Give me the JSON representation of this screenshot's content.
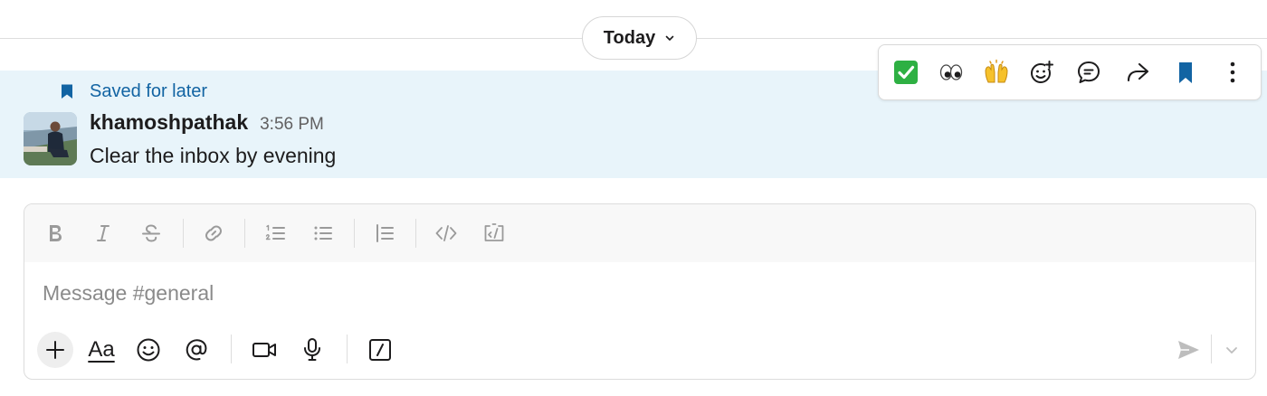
{
  "date_divider": {
    "label": "Today"
  },
  "message": {
    "saved_label": "Saved for later",
    "author": "khamoshpathak",
    "time": "3:56 PM",
    "text": "Clear the inbox by evening"
  },
  "message_actions": [
    {
      "name": "check-mark-reaction",
      "icon": "white-check-mark-emoji"
    },
    {
      "name": "eyes-reaction",
      "icon": "eyes-emoji"
    },
    {
      "name": "raised-hands-reaction",
      "icon": "raised-hands-emoji"
    },
    {
      "name": "add-reaction",
      "icon": "add-emoji-icon"
    },
    {
      "name": "reply-in-thread",
      "icon": "thread-icon"
    },
    {
      "name": "share-message",
      "icon": "forward-icon"
    },
    {
      "name": "save-for-later",
      "icon": "bookmark-icon"
    },
    {
      "name": "more-actions",
      "icon": "kebab-icon"
    }
  ],
  "composer": {
    "placeholder": "Message #general",
    "text_formatting_label": "Aa",
    "formatting_tools": [
      "bold",
      "italic",
      "strikethrough",
      "link",
      "ordered-list",
      "bulleted-list",
      "blockquote",
      "code",
      "code-block"
    ]
  },
  "colors": {
    "highlight_bg": "#e8f4fa",
    "saved_blue": "#1264a3",
    "text": "#1d1c1d",
    "muted_icon": "#9a9a9a"
  }
}
